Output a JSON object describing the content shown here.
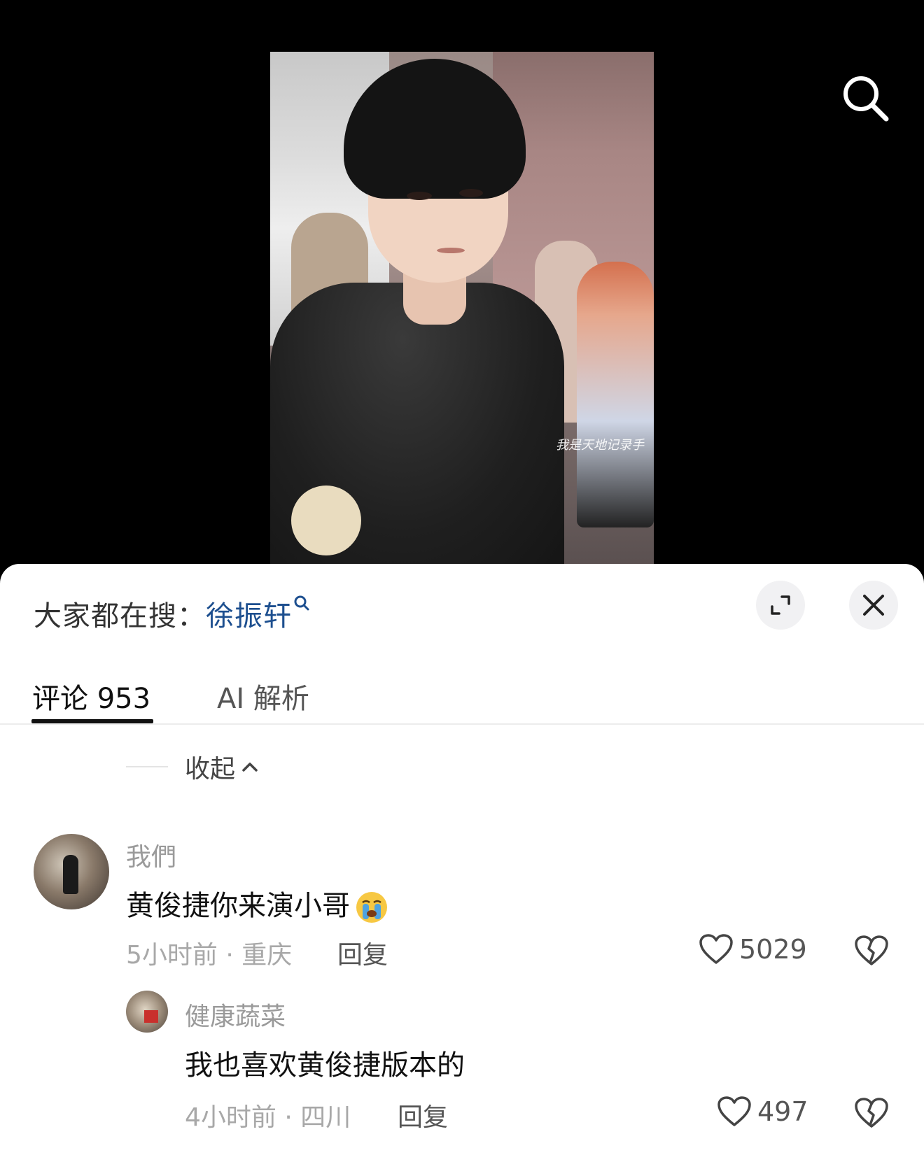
{
  "hot_search": {
    "prefix": "大家都在搜：",
    "keyword": "徐振轩"
  },
  "icons": {
    "search": "search-icon",
    "expand": "expand-icon",
    "close": "close-icon",
    "like": "heart-icon",
    "dislike": "broken-heart-icon"
  },
  "tabs": [
    {
      "label": "评论 953",
      "active": true
    },
    {
      "label": "AI 解析",
      "active": false
    }
  ],
  "collapse_label": "收起",
  "comments": [
    {
      "username": "我們",
      "text": "黄俊捷你来演小哥",
      "emoji": "crying-face",
      "time": "5小时前 · 重庆",
      "reply_label": "回复",
      "likes": "5029"
    },
    {
      "username": "健康蔬菜",
      "text": "我也喜欢黄俊捷版本的",
      "time": "4小时前 · 四川",
      "reply_label": "回复",
      "likes": "497"
    }
  ],
  "video": {
    "watermark": "我是天地记录手"
  }
}
